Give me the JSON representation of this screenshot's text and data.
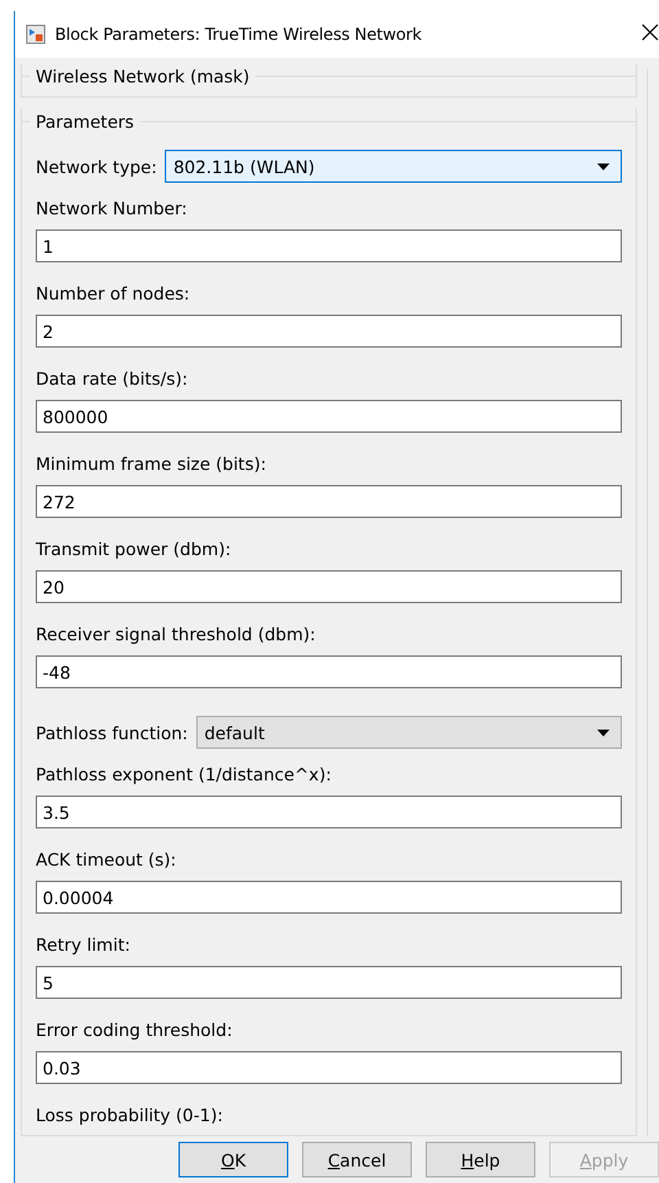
{
  "window": {
    "title": "Block Parameters: TrueTime Wireless  Network"
  },
  "mask_group": {
    "title": "Wireless Network (mask)"
  },
  "parameters": {
    "title": "Parameters",
    "fields": [
      {
        "kind": "select",
        "label": "Network type:",
        "value": "802.11b (WLAN)",
        "focused": true
      },
      {
        "kind": "text",
        "label": "Network Number:",
        "value": "1"
      },
      {
        "kind": "text",
        "label": "Number of nodes:",
        "value": "2"
      },
      {
        "kind": "text",
        "label": "Data rate (bits/s):",
        "value": "800000"
      },
      {
        "kind": "text",
        "label": "Minimum frame size (bits):",
        "value": "272"
      },
      {
        "kind": "text",
        "label": "Transmit power (dbm):",
        "value": "20"
      },
      {
        "kind": "text",
        "label": "Receiver signal threshold (dbm):",
        "value": "-48"
      },
      {
        "kind": "select",
        "label": "Pathloss function:",
        "value": "default",
        "focused": false
      },
      {
        "kind": "text",
        "label": "Pathloss exponent (1/distance^x):",
        "value": "3.5"
      },
      {
        "kind": "text",
        "label": "ACK timeout (s):",
        "value": "0.00004"
      },
      {
        "kind": "text",
        "label": "Retry limit:",
        "value": "5"
      },
      {
        "kind": "text",
        "label": "Error coding threshold:",
        "value": "0.03"
      },
      {
        "kind": "label",
        "label": "Loss probability (0-1):"
      }
    ]
  },
  "buttons": [
    {
      "label": "OK",
      "default": true,
      "disabled": false
    },
    {
      "label": "Cancel",
      "default": false,
      "disabled": false
    },
    {
      "label": "Help",
      "default": false,
      "disabled": false
    },
    {
      "label": "Apply",
      "default": false,
      "disabled": true
    }
  ]
}
